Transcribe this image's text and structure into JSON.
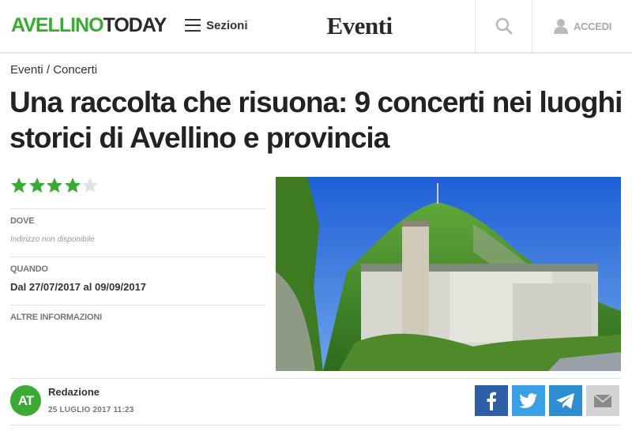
{
  "header": {
    "logo_part1": "AVELLINO",
    "logo_part2": "TODAY",
    "menu_label": "Sezioni",
    "section_title": "Eventi",
    "login_label": "ACCEDI",
    "icons": {
      "menu": "hamburger-icon",
      "search": "search-icon",
      "login": "user-icon"
    }
  },
  "breadcrumb": {
    "section": "Eventi",
    "separator": " / ",
    "category": "Concerti"
  },
  "article": {
    "title": "Una raccolta che risuona: 9 concerti nei luoghi storici di Avellino e provincia",
    "rating": 4,
    "rating_max": 5,
    "dove_label": "DOVE",
    "dove_value": "Indirizzo non disponibile",
    "quando_label": "QUANDO",
    "quando_value": "Dal 27/07/2017 al 09/09/2017",
    "altre_label": "ALTRE INFORMAZIONI"
  },
  "author": {
    "initials": "AT",
    "name": "Redazione",
    "date": "25 LUGLIO 2017 11:23"
  },
  "share": {
    "icons": [
      "facebook-icon",
      "twitter-icon",
      "telegram-icon",
      "email-icon"
    ]
  },
  "colors": {
    "brand_green": "#3aaa35",
    "star_green": "#3aaa35",
    "star_empty": "#dfe3e8",
    "facebook": "#2d5ea6",
    "twitter": "#3aa0e3",
    "telegram": "#2c8ed1",
    "email": "#d4d4d4"
  }
}
